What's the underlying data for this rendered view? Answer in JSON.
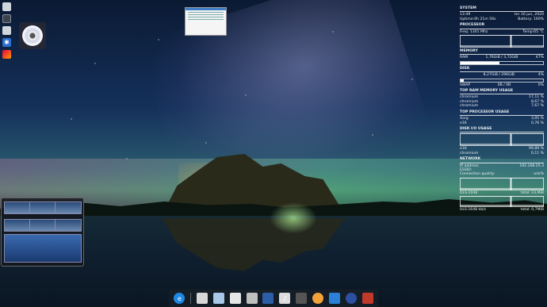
{
  "conky": {
    "system_title": "SYSTEM",
    "time": "13:49",
    "date": "ter 16 jun, 2020",
    "uptime": "Uptime:0h 21m 56s",
    "battery": "Battery: 100%",
    "processor_title": "PROCESSOR",
    "freq": "Freq: 1301 Mhz",
    "temp": "Temp:65 °C",
    "memory_title": "MEMORY",
    "ram_label": "RAM",
    "ram_value": "1,76GiB / 3,72GiB",
    "ram_pct": "47%",
    "ram_fraction": 0.47,
    "disk_title": "DISK",
    "disk_value": "8,27GiB / 296GiB",
    "disk_pct": "4%",
    "disk_fraction": 0.04,
    "swap_label": "SWAP",
    "swap_value": "0B / 0B",
    "swap_pct": "0%",
    "top_ram_title": "TOP RAM MEMORY USAGE",
    "top_ram": [
      {
        "name": "chromium",
        "value": "17,11 %"
      },
      {
        "name": "chromium",
        "value": "8,67 %"
      },
      {
        "name": "chromium",
        "value": "7,67 %"
      }
    ],
    "top_cpu_title": "TOP PROCESSOR USAGE",
    "top_cpu": [
      {
        "name": "Xorg",
        "value": "3,05 %"
      },
      {
        "name": "e16",
        "value": "0,76 %"
      }
    ],
    "disk_io_title": "DISK I/O USAGE",
    "disk_io": [
      {
        "name": "e16",
        "value": "99,89 %"
      },
      {
        "name": "chromium",
        "value": "0,11 %"
      }
    ],
    "network_title": "NETWORK",
    "ip_label": "IP address",
    "ip_value": "192.168.25.3",
    "essid_label": "ESSID:",
    "quality_label": "Connection quality:",
    "quality_value": "unk%",
    "dls_label": "DLS:2048",
    "dls_total": "total: 23,MiB",
    "uls_label": "ULS:1648  kb/s",
    "uls_total": "total: 0,7MiB"
  }
}
